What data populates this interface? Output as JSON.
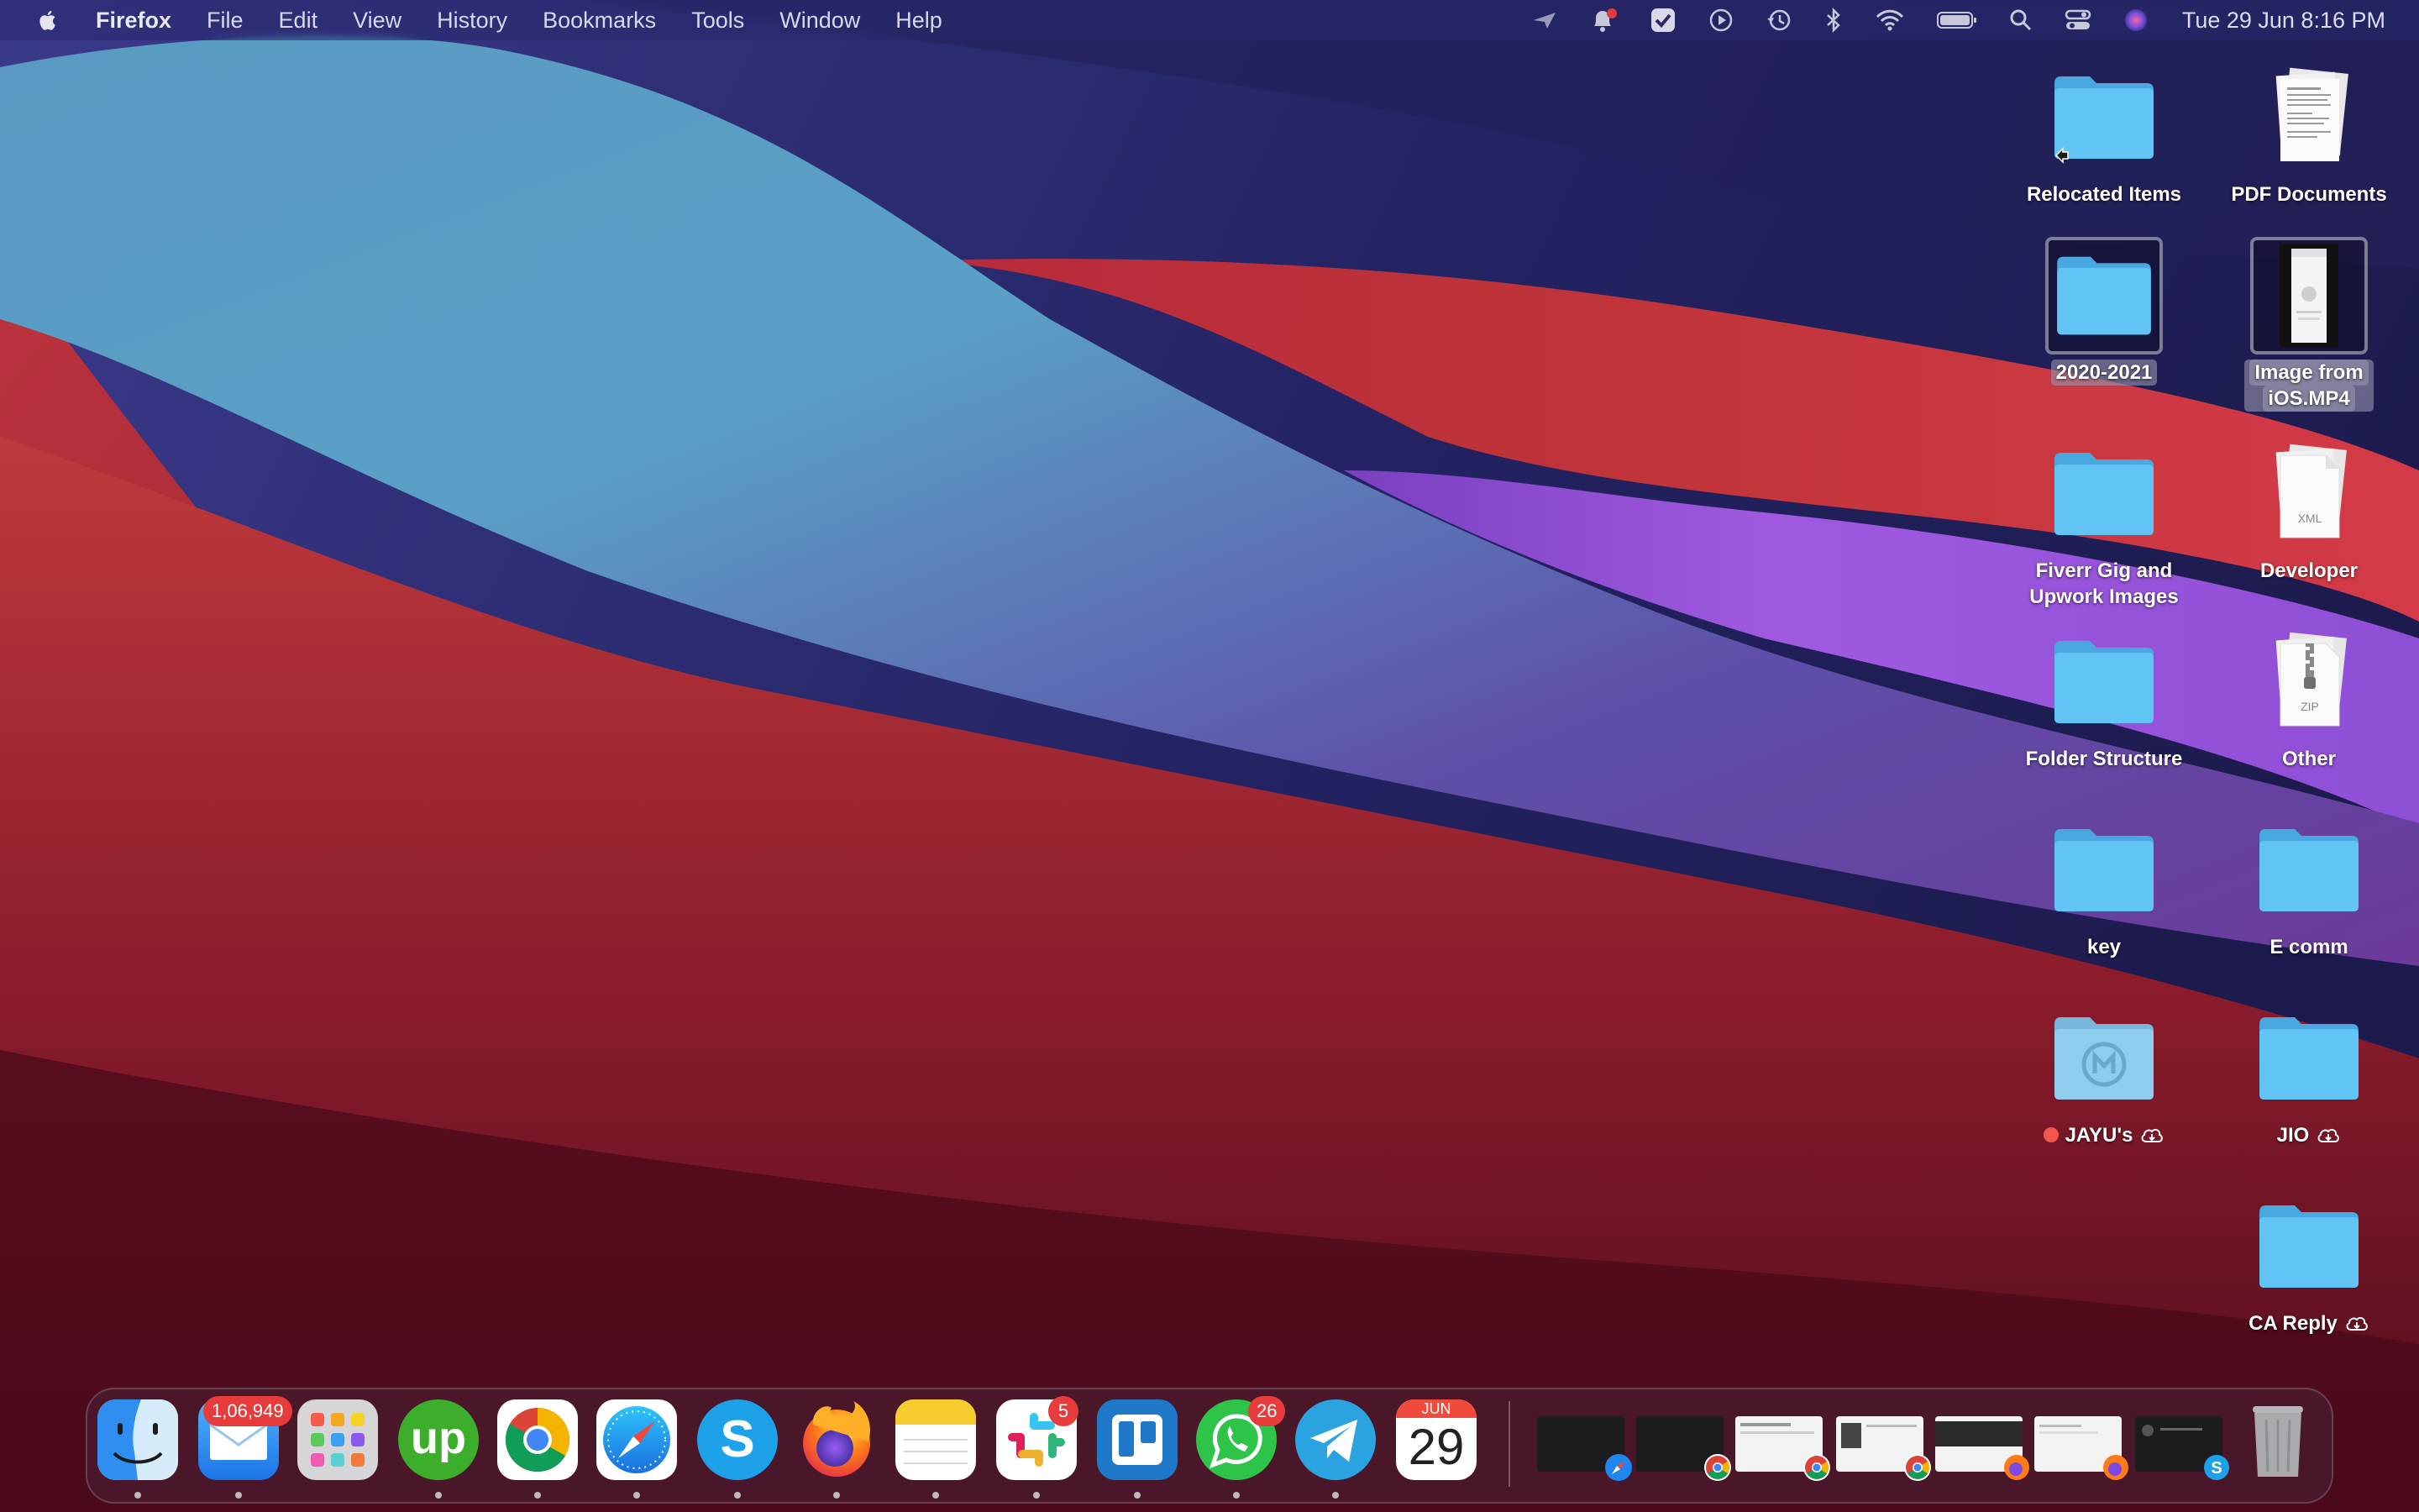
{
  "menubar": {
    "app_name": "Firefox",
    "menus": [
      "File",
      "Edit",
      "View",
      "History",
      "Bookmarks",
      "Tools",
      "Window",
      "Help"
    ],
    "status_icons": [
      "location-icon",
      "notification-icon",
      "tasks-icon",
      "play-icon",
      "time-machine-icon",
      "bluetooth-icon",
      "wifi-icon",
      "battery-icon",
      "spotlight-icon",
      "control-center-icon",
      "siri-icon"
    ],
    "clock": "Tue 29 Jun  8:16 PM"
  },
  "desktop": {
    "items": [
      {
        "label": "Relocated Items",
        "kind": "folder-alias"
      },
      {
        "label": "PDF Documents",
        "kind": "documents-stack"
      },
      {
        "label": "2020-2021",
        "kind": "folder",
        "selected": true
      },
      {
        "label": "Image from iOS.MP4",
        "label_line1": "Image from",
        "label_line2": "iOS.MP4",
        "kind": "video-file",
        "selected": true
      },
      {
        "label": "Fiverr Gig and Upwork Images",
        "label_line1": "Fiverr Gig and",
        "label_line2": "Upwork Images",
        "kind": "folder"
      },
      {
        "label": "Developer",
        "kind": "xml-stack",
        "file_tag": "XML"
      },
      {
        "label": "Folder Structure",
        "kind": "folder"
      },
      {
        "label": "Other",
        "kind": "zip-stack",
        "file_tag": "ZIP"
      },
      {
        "label": "key",
        "kind": "folder"
      },
      {
        "label": "E comm",
        "kind": "folder"
      },
      {
        "label": "JAYU's",
        "kind": "shared-folder",
        "tag": "red",
        "icloud": true
      },
      {
        "label": "JIO",
        "kind": "folder",
        "icloud": true
      },
      {
        "label": "CA Reply",
        "kind": "folder",
        "icloud": true
      }
    ]
  },
  "dock": {
    "apps": [
      {
        "name": "Finder",
        "icon": "finder-icon"
      },
      {
        "name": "Mail",
        "icon": "mail-icon",
        "badge": "1,06,949"
      },
      {
        "name": "Launchpad",
        "icon": "launchpad-icon"
      },
      {
        "name": "Upwork",
        "icon": "upwork-icon",
        "text": "up"
      },
      {
        "name": "Google Chrome",
        "icon": "chrome-icon"
      },
      {
        "name": "Safari",
        "icon": "safari-icon"
      },
      {
        "name": "Skype",
        "icon": "skype-icon",
        "text": "S"
      },
      {
        "name": "Firefox",
        "icon": "firefox-icon"
      },
      {
        "name": "Notes",
        "icon": "notes-icon"
      },
      {
        "name": "Slack",
        "icon": "slack-icon",
        "badge": "5"
      },
      {
        "name": "Trello",
        "icon": "trello-icon"
      },
      {
        "name": "WhatsApp",
        "icon": "whatsapp-icon",
        "badge": "26"
      },
      {
        "name": "Telegram",
        "icon": "telegram-icon"
      },
      {
        "name": "Calendar",
        "icon": "calendar-icon",
        "month": "JUN",
        "day": "29"
      }
    ],
    "minimized": [
      {
        "app": "Safari",
        "style": "dark"
      },
      {
        "app": "Chrome",
        "style": "dark"
      },
      {
        "app": "Chrome",
        "style": "light"
      },
      {
        "app": "Chrome",
        "style": "light"
      },
      {
        "app": "Firefox",
        "style": "light"
      },
      {
        "app": "Firefox",
        "style": "light"
      },
      {
        "app": "Skype",
        "style": "dark"
      }
    ],
    "trash": {
      "name": "Trash",
      "icon": "trash-icon"
    }
  },
  "colors": {
    "folder_blue": "#5cc0f2",
    "badge_red": "#e83b3b",
    "tag_red": "#f2564d"
  }
}
